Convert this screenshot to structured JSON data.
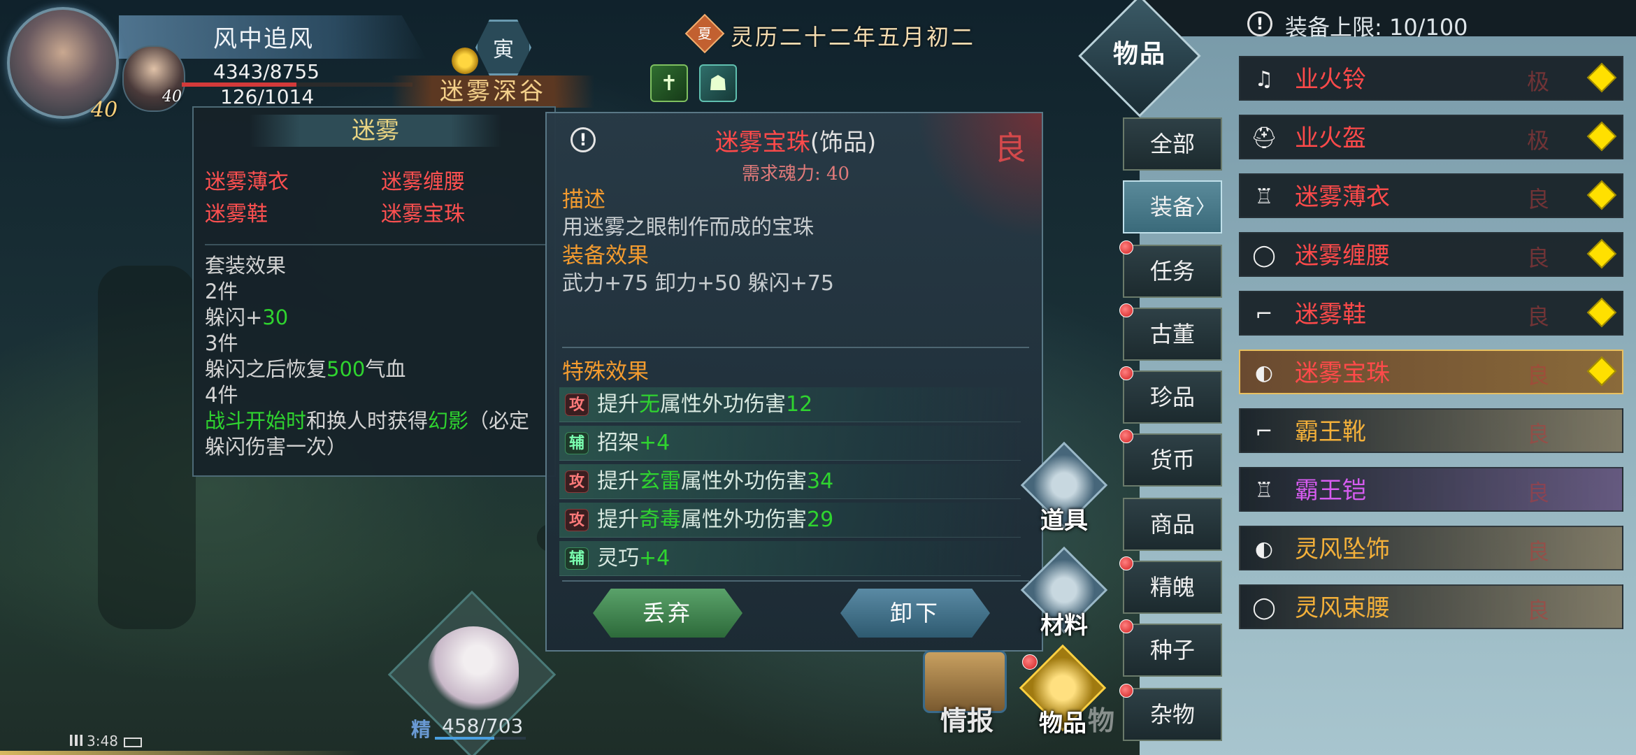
{
  "player": {
    "name": "风中追风",
    "level_main": "40",
    "level_companion": "40",
    "hp": "4343/8755",
    "hp_fraction": 0.496,
    "mp": "126/1014",
    "time_glyph": "寅",
    "location": "迷雾深谷",
    "date_glyph": "夏",
    "date": "灵历二十二年五月初二",
    "buff_icons": [
      "shield-cross-icon",
      "party-icon"
    ]
  },
  "set_panel": {
    "title": "迷雾",
    "items": [
      "迷雾薄衣",
      "迷雾缠腰",
      "迷雾鞋",
      "迷雾宝珠"
    ],
    "effects_title": "套装效果",
    "tier2_label": "2件",
    "tier2_a": "躲闪+",
    "tier2_b": "30",
    "tier3_label": "3件",
    "tier3_a": "躲闪之后恢复",
    "tier3_b": "500",
    "tier3_c": "气血",
    "tier4_label": "4件",
    "tier4_a": "战斗开始时",
    "tier4_b": "和换人时获得",
    "tier4_c": "幻影",
    "tier4_d": "（必定",
    "tier4_e": "躲闪伤害一次）"
  },
  "detail": {
    "name": "迷雾宝珠",
    "type": "(饰品)",
    "grade": "良",
    "requirement": "需求魂力: 40",
    "desc_label": "描述",
    "desc_text": "用迷雾之眼制作而成的宝珠",
    "equip_label": "装备效果",
    "equip_text": "武力+75  卸力+50  躲闪+75",
    "special_label": "特殊效果",
    "special": [
      {
        "tag": "攻",
        "a": "提升",
        "b": "无",
        "c": "属性外功伤害",
        "d": "12"
      },
      {
        "tag": "辅",
        "a": "招架",
        "b": "+4"
      },
      {
        "tag": "攻",
        "a": "提升",
        "b": "玄雷",
        "c": "属性外功伤害",
        "d": "34"
      },
      {
        "tag": "攻",
        "a": "提升",
        "b": "奇毒",
        "c": "属性外功伤害",
        "d": "29"
      },
      {
        "tag": "辅",
        "a": "灵巧",
        "b": "+4"
      }
    ],
    "discard_label": "丢弃",
    "unequip_label": "卸下"
  },
  "inventory": {
    "title": "物品",
    "capacity": "装备上限: 10/100",
    "categories": [
      "全部",
      "装备",
      "任务",
      "古董",
      "珍品",
      "货币",
      "商品",
      "精魄",
      "种子",
      "杂物"
    ],
    "active_category": "装备",
    "items": [
      {
        "name": "业火铃",
        "grade": "极",
        "color": "#ff4a4a",
        "icon": "bell-icon",
        "equipped": true
      },
      {
        "name": "业火盔",
        "grade": "极",
        "color": "#ff4a4a",
        "icon": "helmet-icon",
        "equipped": true
      },
      {
        "name": "迷雾薄衣",
        "grade": "良",
        "color": "#ff4a4a",
        "icon": "robe-icon",
        "equipped": true
      },
      {
        "name": "迷雾缠腰",
        "grade": "良",
        "color": "#ff4a4a",
        "icon": "belt-icon",
        "equipped": true
      },
      {
        "name": "迷雾鞋",
        "grade": "良",
        "color": "#ff4a4a",
        "icon": "boot-icon",
        "equipped": true
      },
      {
        "name": "迷雾宝珠",
        "grade": "良",
        "color": "#ff4a4a",
        "icon": "pendant-icon",
        "equipped": true
      },
      {
        "name": "霸王靴",
        "grade": "良",
        "color": "#f3b03a",
        "icon": "boot-icon",
        "equipped": false
      },
      {
        "name": "霸王铠",
        "grade": "良",
        "color": "#d65cf0",
        "icon": "robe-icon",
        "equipped": false
      },
      {
        "name": "灵风坠饰",
        "grade": "良",
        "color": "#f3b03a",
        "icon": "pendant-icon",
        "equipped": false
      },
      {
        "name": "灵风束腰",
        "grade": "良",
        "color": "#f3b03a",
        "icon": "belt-icon",
        "equipped": false
      }
    ]
  },
  "bottom": {
    "energy_label": "精",
    "energy": "458/703",
    "energy_fraction": 0.651,
    "clock": "3:48",
    "menu_props": "道具",
    "menu_material": "材料",
    "menu_intel": "情报",
    "menu_items": "物品",
    "menu_items_shadow": "物"
  },
  "colors": {
    "red_item": "#ff4a4a",
    "orange_item": "#f3b03a",
    "purple_item": "#d65cf0",
    "green_value": "#2fd42f",
    "section_orange": "#f39b2f"
  }
}
